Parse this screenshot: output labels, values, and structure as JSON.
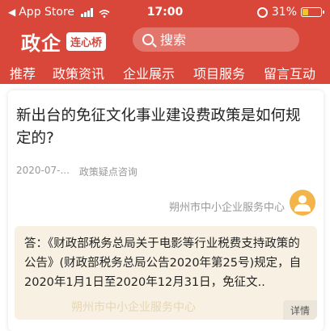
{
  "status_bar": {
    "back_app": "App Store",
    "time": "17:00",
    "battery_text": "31%",
    "battery_level": 0.31
  },
  "header": {
    "brand_name": "政企",
    "brand_badge": "连心桥",
    "search_placeholder": "搜索"
  },
  "tabs": [
    {
      "label": "推荐"
    },
    {
      "label": "政策资讯"
    },
    {
      "label": "企业展示"
    },
    {
      "label": "项目服务"
    },
    {
      "label": "留言互动"
    }
  ],
  "card": {
    "question_title": "新出台的免征文化事业建设费政策是如何规定的?",
    "date": "2020-07-...",
    "category": "政策疑点咨询",
    "answerer": "朔州市中小企业服务中心",
    "answer": "答：《财政部税务总局关于电影等行业税费支持政策的公告》(财政部税务总局公告2020年第25号)规定，自2020年1月1日至2020年12月31日，免征文..",
    "watermark": "朔州市中小企业服务中心",
    "detail_label": "详情"
  },
  "colors": {
    "brand_red": "#d9473b",
    "answer_bg": "#f8f1e3",
    "avatar_bg": "#f3b54a"
  }
}
